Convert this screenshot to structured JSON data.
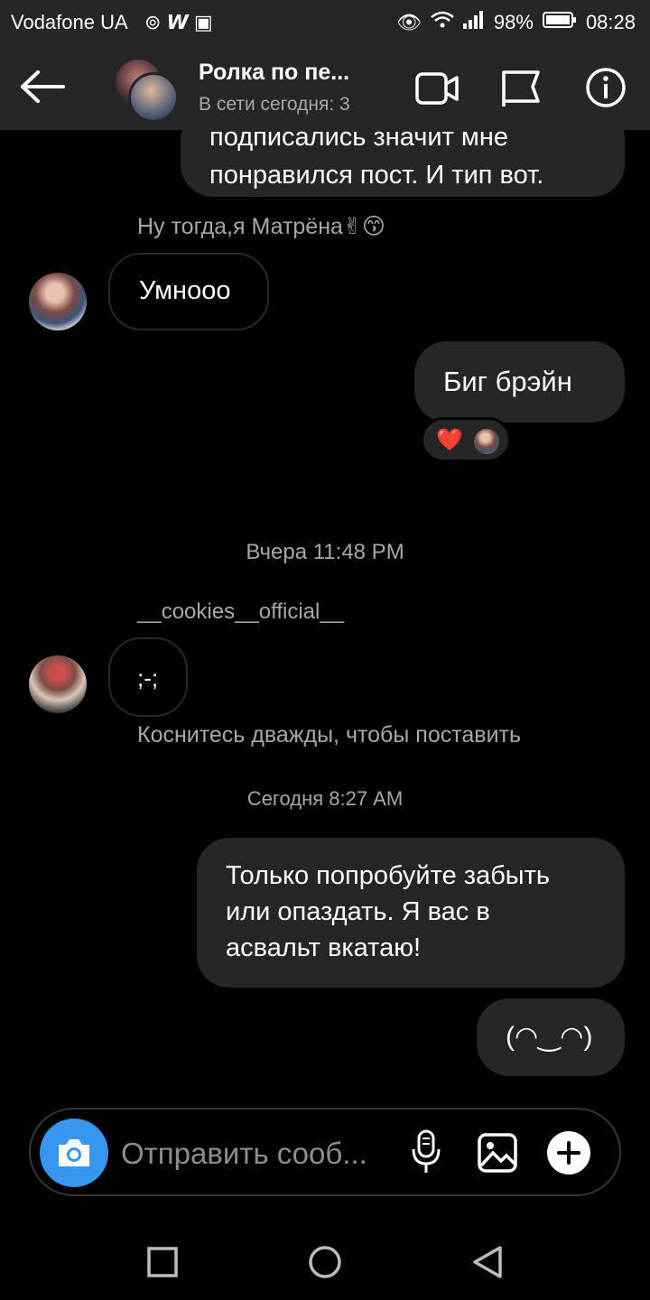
{
  "status_bar": {
    "carrier": "Vodafone UA",
    "battery": "98%",
    "time": "08:28"
  },
  "header": {
    "title": "Ролка по пе...",
    "subtitle": "В сети сегодня: 3"
  },
  "messages": {
    "top_cut_line": "подписались значит мне",
    "top_line": "понравился пост. И тип вот.",
    "reply_caption": "Ну тогда,я Матрёна✌😙",
    "umnooo": "Умнооо",
    "big_brain": "Биг брэйн",
    "reaction_emoji": "❤️",
    "date_yesterday": "Вчера 11:48 PM",
    "sender_name": "__cookies__official__",
    "sad_face": ";-;",
    "double_tap_hint": "Коснитесь дважды, чтобы поставить",
    "date_today": "Сегодня 8:27 AM",
    "long_msg_line1": "Только попробуйте забыть",
    "long_msg_line2": "или опаздать. Я вас в",
    "long_msg_line3": "асвальт вкатаю!",
    "kaomoji": "(◠‿◠)"
  },
  "composer": {
    "placeholder": "Отправить сооб..."
  },
  "colors": {
    "bg": "#000000",
    "bar": "#262626",
    "accent": "#3797f0",
    "muted": "#a8a8a8"
  }
}
